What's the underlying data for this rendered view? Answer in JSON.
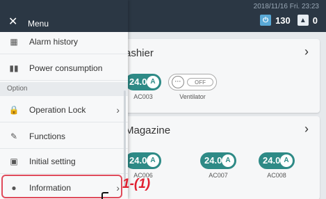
{
  "topbar": {
    "datetime": "2018/11/16 Fri. 23:23",
    "power_value": "130",
    "alarm_value": "0"
  },
  "cards": [
    {
      "title": "ashier",
      "units": [
        {
          "temp": "24.0",
          "mode": "A",
          "label": "AC003"
        }
      ],
      "vent": {
        "state": "OFF",
        "label": "Ventilator"
      }
    },
    {
      "title": "Magazine",
      "units": [
        {
          "temp": "24.0",
          "mode": "A",
          "label": "AC006"
        },
        {
          "temp": "24.0",
          "mode": "A",
          "label": "AC007"
        },
        {
          "temp": "24.0",
          "mode": "A",
          "label": "AC008"
        }
      ]
    }
  ],
  "menu": {
    "title": "Menu",
    "items_top": [
      {
        "label": "Alarm history",
        "icon": "alarm-history-icon"
      },
      {
        "label": "Power consumption",
        "icon": "power-consumption-icon"
      }
    ],
    "section": "Option",
    "items_option": [
      {
        "label": "Operation Lock",
        "icon": "lock-icon",
        "chevron": true
      },
      {
        "label": "Functions",
        "icon": "wrench-icon",
        "chevron": false
      },
      {
        "label": "Initial setting",
        "icon": "initial-setting-icon",
        "chevron": false
      },
      {
        "label": "Information",
        "icon": "info-icon",
        "chevron": true
      }
    ]
  },
  "annotation": {
    "label": "1-(1)"
  },
  "colors": {
    "accent": "#2e8a86",
    "header": "#2b3744",
    "highlight": "#e04a5a"
  }
}
